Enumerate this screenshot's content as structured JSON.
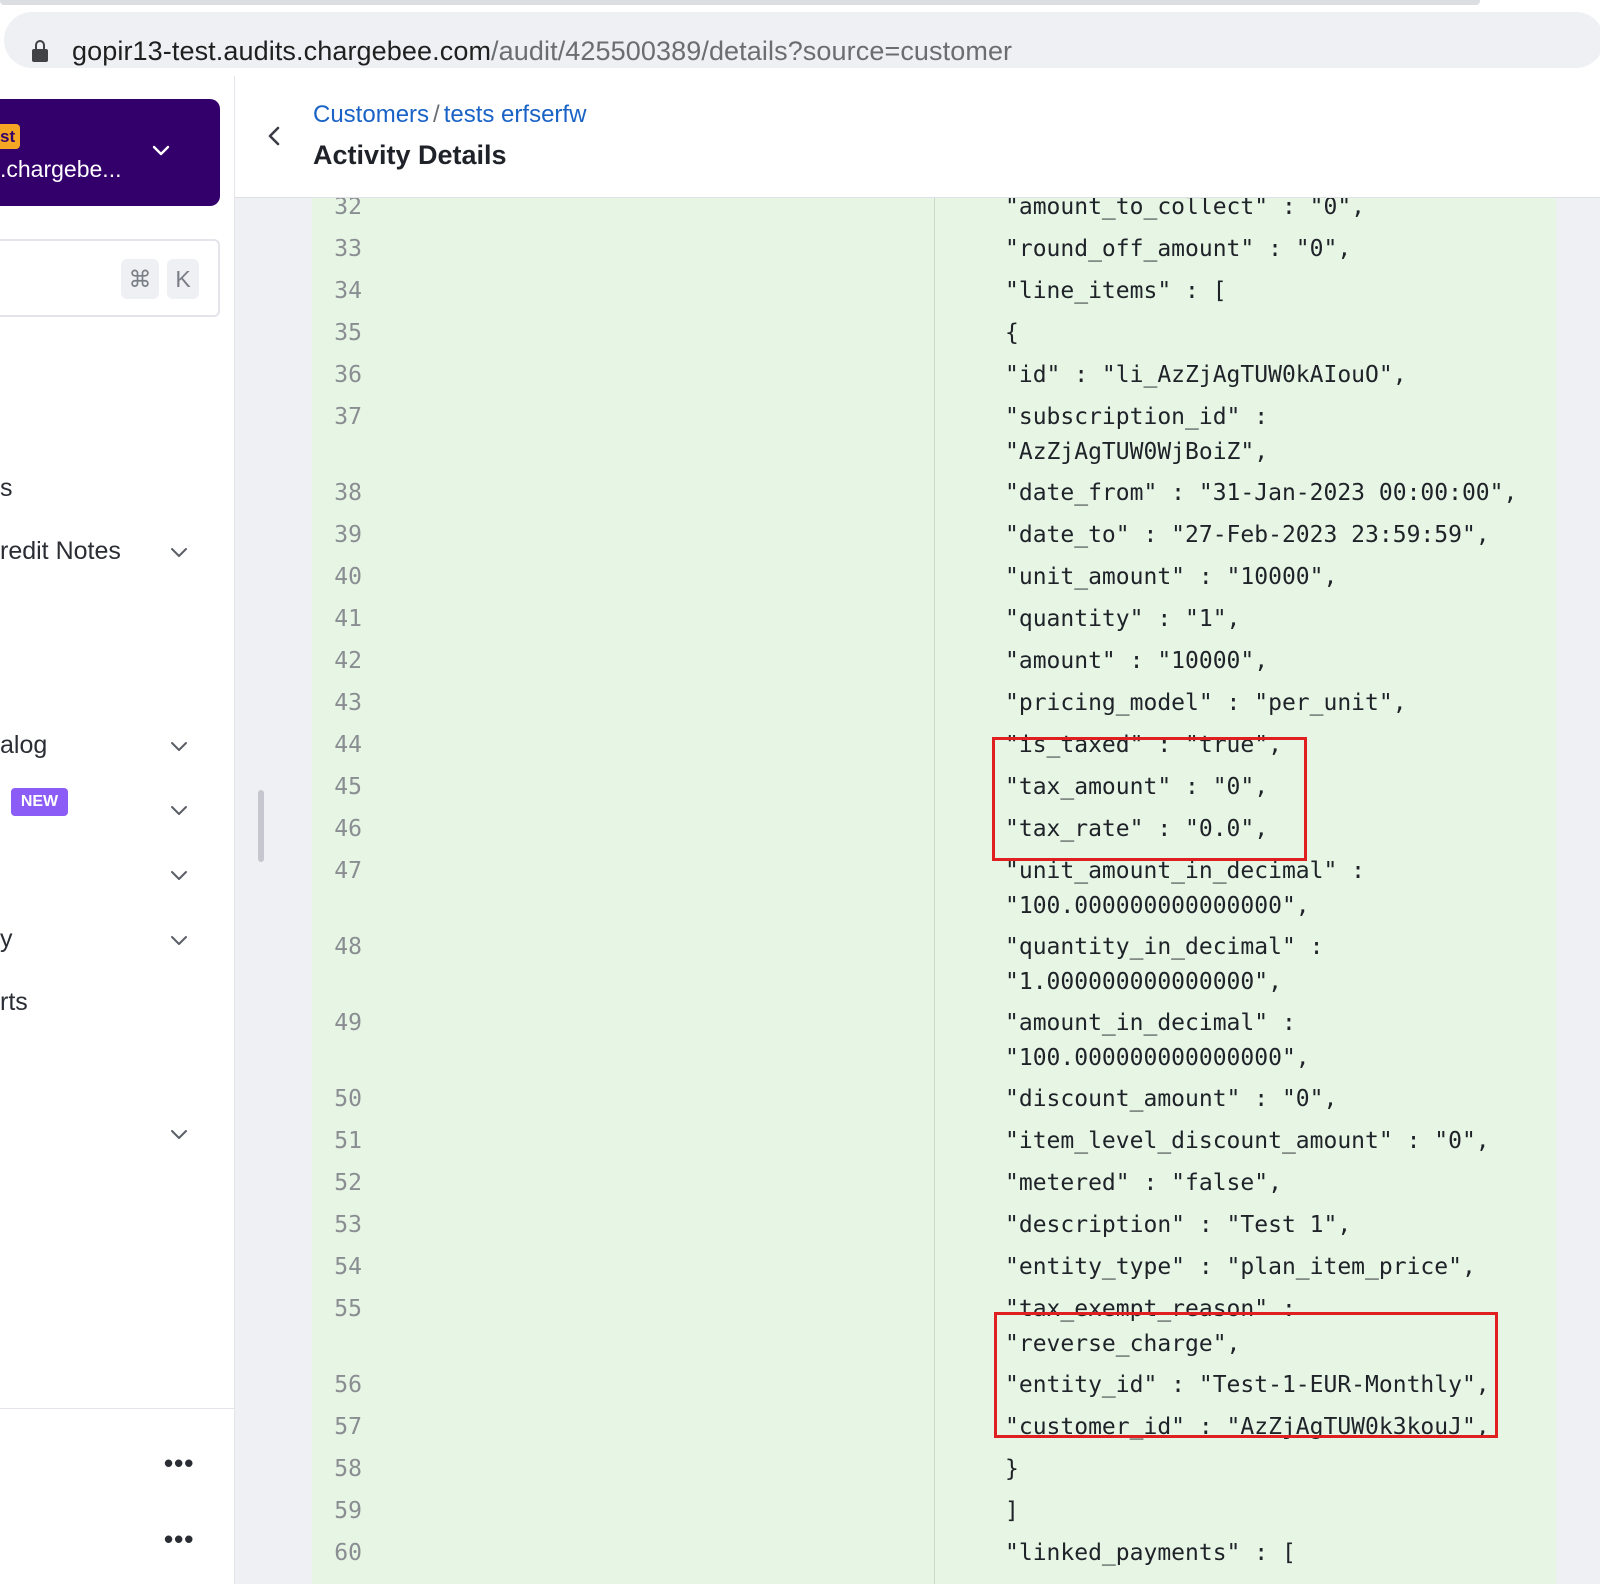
{
  "browser": {
    "url_host": "gopir13-test.audits.chargebee.com",
    "url_path": "/audit/425500389/details?source=customer"
  },
  "sidebar": {
    "site_badge": "st",
    "site_name": ".chargebe...",
    "search_keys": [
      "⌘",
      "K"
    ],
    "items": [
      {
        "label": "s"
      },
      {
        "label": "redit Notes"
      },
      {
        "label": "alog"
      },
      {
        "label": ""
      },
      {
        "label": ""
      },
      {
        "label": "y"
      },
      {
        "label": "rts"
      },
      {
        "label": ""
      }
    ],
    "new_badge": "NEW",
    "more_1": "•••",
    "more_2": "•••"
  },
  "header": {
    "breadcrumb_1": "Customers",
    "breadcrumb_sep": "/",
    "breadcrumb_2": "tests erfserfw",
    "title": "Activity Details"
  },
  "code_lines": [
    {
      "n": "32",
      "text": "\"amount_to_collect\" : \"0\","
    },
    {
      "n": "33",
      "text": "\"round_off_amount\" : \"0\","
    },
    {
      "n": "34",
      "text": "\"line_items\" : ["
    },
    {
      "n": "35",
      "text": "{"
    },
    {
      "n": "36",
      "text": "\"id\" : \"li_AzZjAgTUW0kAIouO\","
    },
    {
      "n": "37",
      "text": "\"subscription_id\" :\n\"AzZjAgTUW0WjBoiZ\","
    },
    {
      "n": "38",
      "text": "\"date_from\" : \"31-Jan-2023 00:00:00\","
    },
    {
      "n": "39",
      "text": "\"date_to\" : \"27-Feb-2023 23:59:59\","
    },
    {
      "n": "40",
      "text": "\"unit_amount\" : \"10000\","
    },
    {
      "n": "41",
      "text": "\"quantity\" : \"1\","
    },
    {
      "n": "42",
      "text": "\"amount\" : \"10000\","
    },
    {
      "n": "43",
      "text": "\"pricing_model\" : \"per_unit\","
    },
    {
      "n": "44",
      "text": "\"is_taxed\" : \"true\","
    },
    {
      "n": "45",
      "text": "\"tax_amount\" : \"0\","
    },
    {
      "n": "46",
      "text": "\"tax_rate\" : \"0.0\","
    },
    {
      "n": "47",
      "text": "\"unit_amount_in_decimal\" :\n\"100.000000000000000\","
    },
    {
      "n": "48",
      "text": "\"quantity_in_decimal\" :\n\"1.000000000000000\","
    },
    {
      "n": "49",
      "text": "\"amount_in_decimal\" :\n\"100.000000000000000\","
    },
    {
      "n": "50",
      "text": "\"discount_amount\" : \"0\","
    },
    {
      "n": "51",
      "text": "\"item_level_discount_amount\" : \"0\","
    },
    {
      "n": "52",
      "text": "\"metered\" : \"false\","
    },
    {
      "n": "53",
      "text": "\"description\" : \"Test 1\","
    },
    {
      "n": "54",
      "text": "\"entity_type\" : \"plan_item_price\","
    },
    {
      "n": "55",
      "text": "\"tax_exempt_reason\" :\n\"reverse_charge\","
    },
    {
      "n": "56",
      "text": "\"entity_id\" : \"Test-1-EUR-Monthly\","
    },
    {
      "n": "57",
      "text": "\"customer_id\" : \"AzZjAgTUW0k3kouJ\","
    },
    {
      "n": "58",
      "text": "}"
    },
    {
      "n": "59",
      "text": "]"
    },
    {
      "n": "60",
      "text": "\"linked_payments\" : ["
    }
  ],
  "colors": {
    "site_card": "#33006b",
    "diff_added_bg": "#e6f5e4",
    "highlight_box": "#e02020",
    "link": "#1a63c6",
    "new_badge": "#8b5cf6"
  }
}
